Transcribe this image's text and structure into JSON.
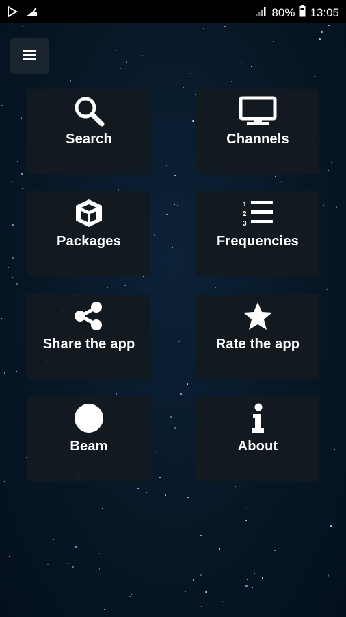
{
  "status_bar": {
    "left_icons": [
      "play-store-notification-icon",
      "android-notification-icon"
    ],
    "signal_icon": "signal-icon",
    "battery_percent": "80%",
    "battery_icon": "battery-icon",
    "time": "13:05"
  },
  "menu": {
    "icon": "hamburger-menu-icon"
  },
  "tiles": [
    {
      "label": "Search",
      "icon": "search-icon"
    },
    {
      "label": "Channels",
      "icon": "monitor-icon"
    },
    {
      "label": "Packages",
      "icon": "cube-icon"
    },
    {
      "label": "Frequencies",
      "icon": "numbered-list-icon"
    },
    {
      "label": "Share the app",
      "icon": "share-icon"
    },
    {
      "label": "Rate the app",
      "icon": "star-icon"
    },
    {
      "label": "Beam",
      "icon": "circle-icon"
    },
    {
      "label": "About",
      "icon": "info-icon"
    }
  ],
  "colors": {
    "background": "#071624",
    "tile": "#141a20",
    "text": "#ffffff"
  }
}
